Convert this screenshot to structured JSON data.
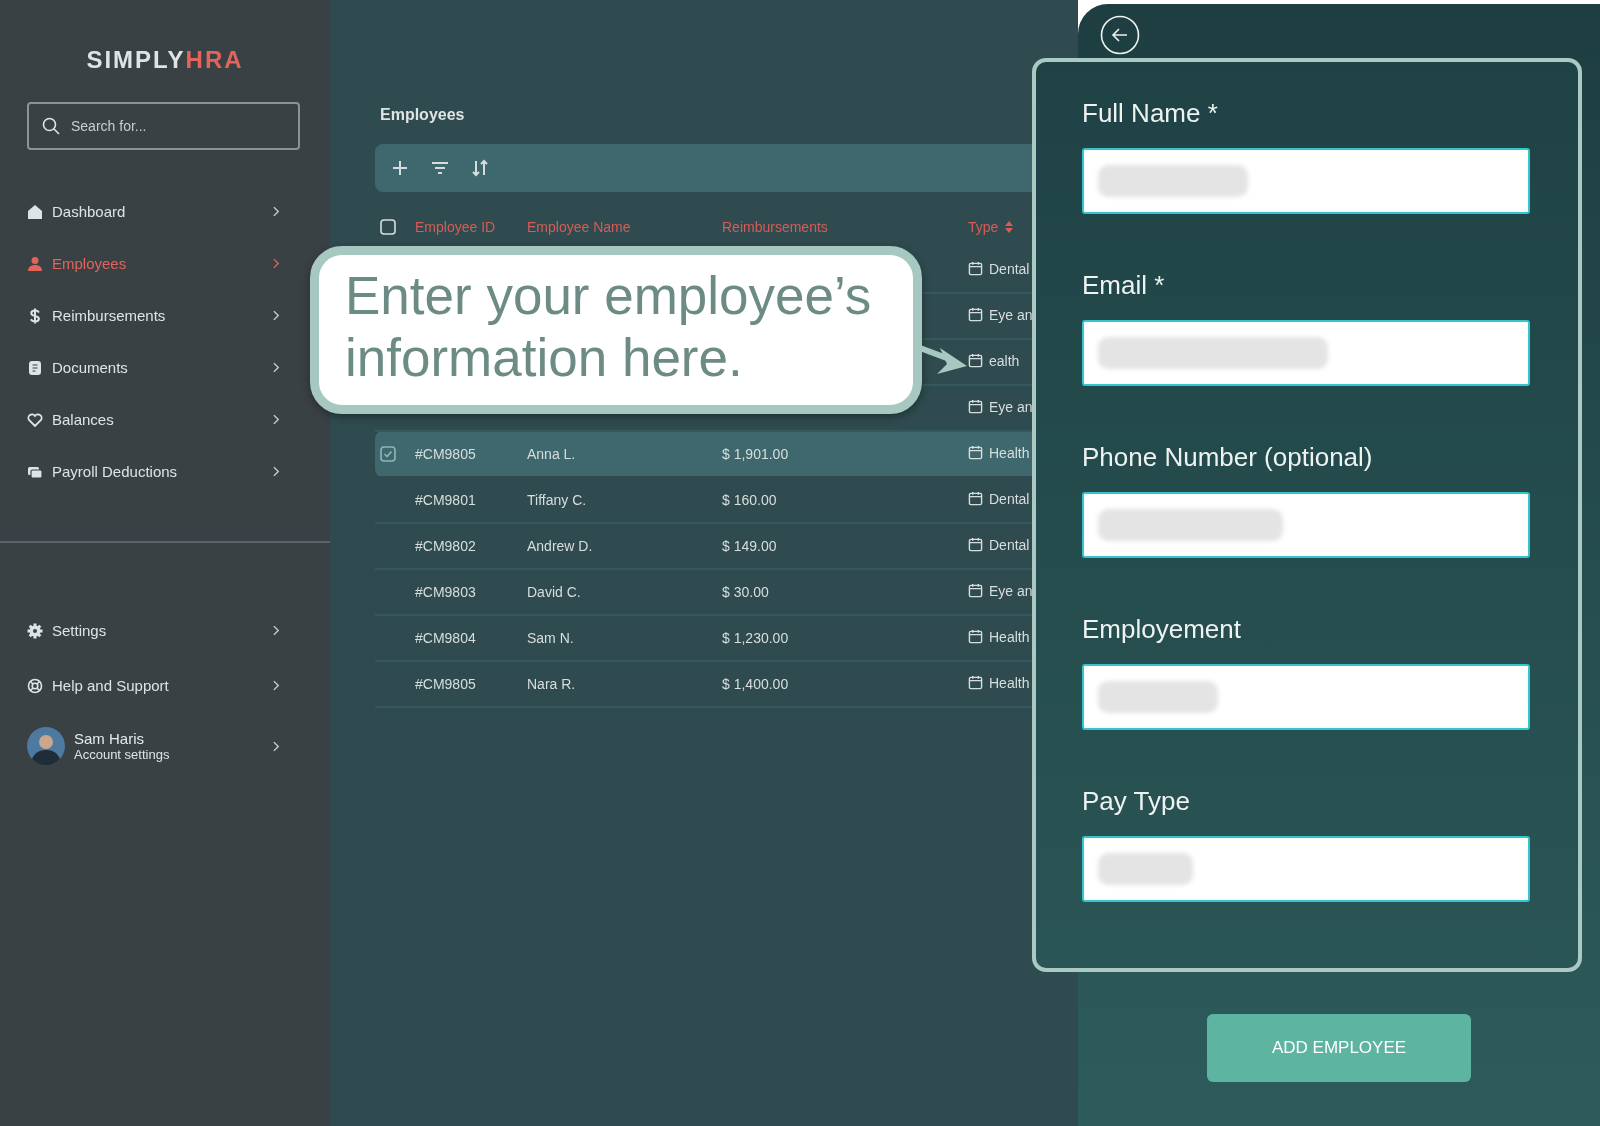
{
  "logo": {
    "part_1": "SIMPLY",
    "part_2": "HRA"
  },
  "search": {
    "placeholder": "Search for..."
  },
  "nav": [
    {
      "label": "Dashboard",
      "selected": false
    },
    {
      "label": "Employees",
      "selected": true
    },
    {
      "label": "Reimbursements",
      "selected": false
    },
    {
      "label": "Documents",
      "selected": false
    },
    {
      "label": "Balances",
      "selected": false
    },
    {
      "label": "Payroll Deductions",
      "selected": false
    }
  ],
  "nav_bottom": [
    {
      "label": "Settings"
    },
    {
      "label": "Help and Support"
    }
  ],
  "user": {
    "name": "Sam Haris",
    "subtitle": "Account settings"
  },
  "page_title": "Employees",
  "table": {
    "header_checked": false,
    "columns": [
      "Employee ID",
      "Employee Name",
      "Reimbursements",
      "Type"
    ],
    "rows": [
      {
        "id": "",
        "name": "",
        "amount": "",
        "type": "Dental",
        "selected": false
      },
      {
        "id": "",
        "name": "",
        "amount": "",
        "type": "Eye an",
        "selected": false
      },
      {
        "id": "",
        "name": "",
        "amount": "",
        "type": "ealth",
        "selected": false
      },
      {
        "id": "",
        "name": "",
        "amount": "",
        "type": "Eye an",
        "selected": false
      },
      {
        "id": "#CM9805",
        "name": "Anna L.",
        "amount": "$ 1,901.00",
        "type": "Health",
        "selected": true
      },
      {
        "id": "#CM9801",
        "name": "Tiffany C.",
        "amount": "$ 160.00",
        "type": "Dental",
        "selected": false
      },
      {
        "id": "#CM9802",
        "name": "Andrew D.",
        "amount": "$ 149.00",
        "type": "Dental",
        "selected": false
      },
      {
        "id": "#CM9803",
        "name": "David C.",
        "amount": "$ 30.00",
        "type": "Eye an",
        "selected": false
      },
      {
        "id": "#CM9804",
        "name": "Sam N.",
        "amount": "$ 1,230.00",
        "type": "Health",
        "selected": false
      },
      {
        "id": "#CM9805",
        "name": "Nara R.",
        "amount": "$ 1,400.00",
        "type": "Health",
        "selected": false
      }
    ]
  },
  "callout": {
    "text": "Enter your employee’s information here."
  },
  "form": {
    "fields": [
      {
        "label": "Full Name *"
      },
      {
        "label": "Email *"
      },
      {
        "label": "Phone Number (optional)"
      },
      {
        "label": "Employement"
      },
      {
        "label": "Pay Type"
      }
    ],
    "submit": "ADD EMPLOYEE"
  }
}
